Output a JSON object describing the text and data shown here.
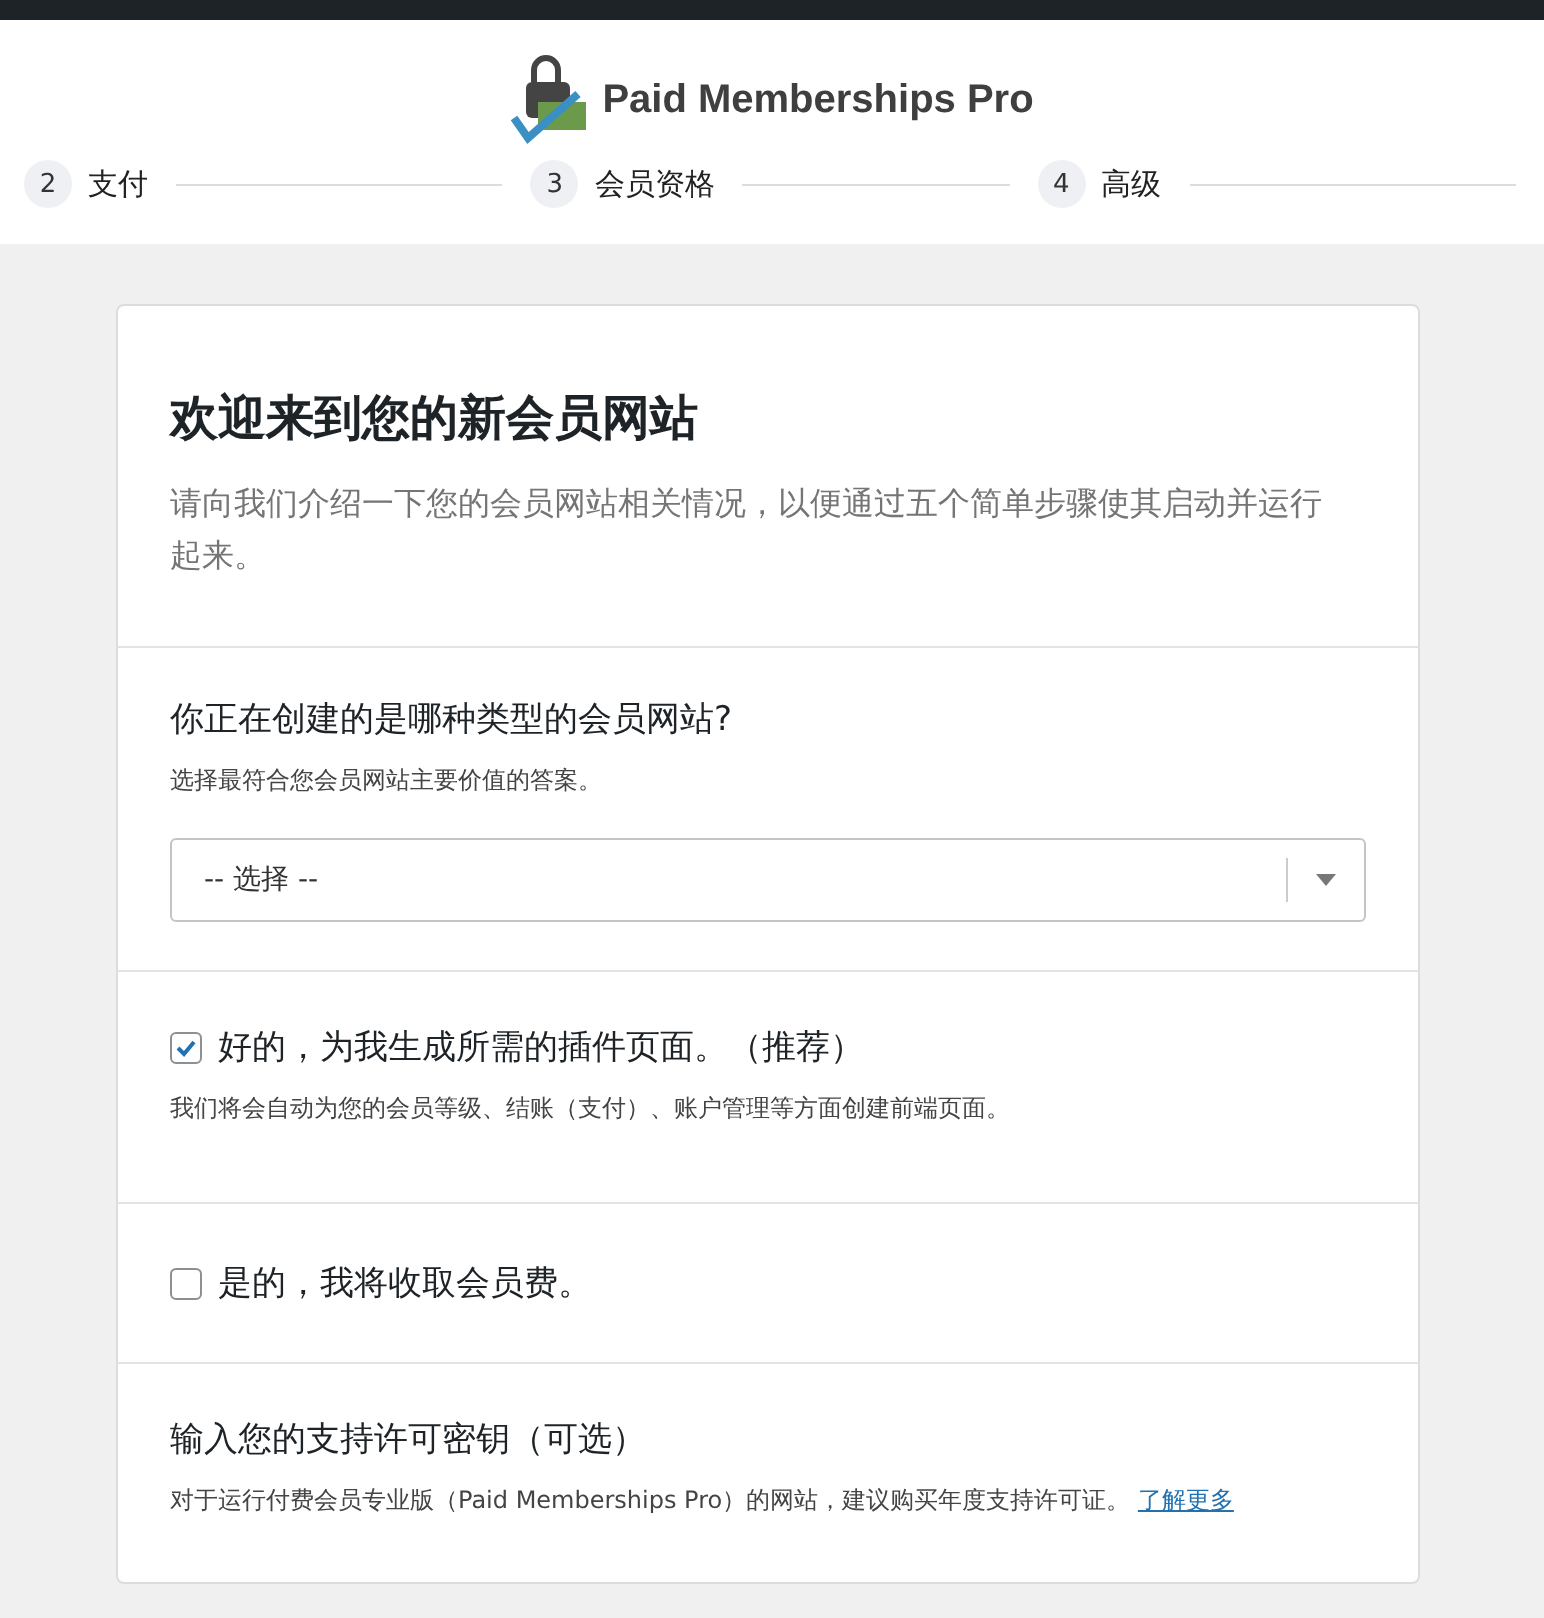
{
  "header": {
    "brand": "Paid Memberships Pro"
  },
  "steps": [
    {
      "number": "2",
      "label": "支付"
    },
    {
      "number": "3",
      "label": "会员资格"
    },
    {
      "number": "4",
      "label": "高级"
    }
  ],
  "intro": {
    "title": "欢迎来到您的新会员网站",
    "description": "请向我们介绍一下您的会员网站相关情况，以便通过五个简单步骤使其启动并运行起来。"
  },
  "site_type": {
    "label": "你正在创建的是哪种类型的会员网站?",
    "hint": "选择最符合您会员网站主要价值的答案。",
    "select_value": "-- 选择 --"
  },
  "options": [
    {
      "label": "好的，为我生成所需的插件页面。（推荐）",
      "hint": "我们将会自动为您的会员等级、结账（支付）、账户管理等方面创建前端页面。",
      "checked": true
    },
    {
      "label": "是的，我将收取会员费。",
      "checked": false
    }
  ],
  "license": {
    "label": "输入您的支持许可密钥（可选）",
    "description": "对于运行付费会员专业版（Paid Memberships Pro）的网站，建议购买年度支持许可证。",
    "link": "了解更多"
  }
}
